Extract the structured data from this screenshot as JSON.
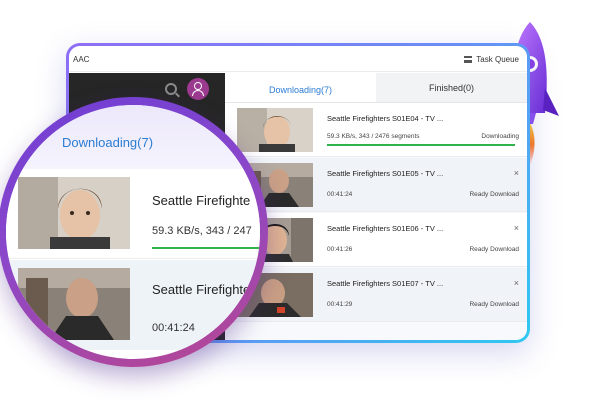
{
  "window": {
    "app_title": "AAC",
    "task_queue_label": "Task Queue"
  },
  "tabs": [
    {
      "label": "Downloading(7)",
      "active": true
    },
    {
      "label": "Finished(0)",
      "active": false
    }
  ],
  "downloads": [
    {
      "title": "Seattle Firefighters S01E04 - TV ...",
      "speed": "59.3 KB/s, 343 / 2476 segments",
      "status": "Downloading",
      "progress": 0.55
    },
    {
      "title": "Seattle Firefighters S01E05 - TV ...",
      "duration": "00:41:24",
      "status": "Ready Download"
    },
    {
      "title": "Seattle Firefighters S01E06 - TV ...",
      "duration": "00:41:26",
      "status": "Ready Download"
    },
    {
      "title": "Seattle Firefighters S01E07 - TV ...",
      "duration": "00:41:29",
      "status": "Ready Download"
    }
  ],
  "magnifier": {
    "tab_label": "Downloading(7)",
    "row1_title": "Seattle Firefighte",
    "row1_speed": "59.3 KB/s, 343 / 247",
    "row2_title": "Seattle Firefighte",
    "row2_duration": "00:41:24"
  },
  "colors": {
    "accent": "#2b7cd3",
    "progress": "#2fb34a",
    "lens_ring_start": "#6d3ed6",
    "lens_ring_end": "#b9478f"
  },
  "icons": {
    "close": "×"
  }
}
